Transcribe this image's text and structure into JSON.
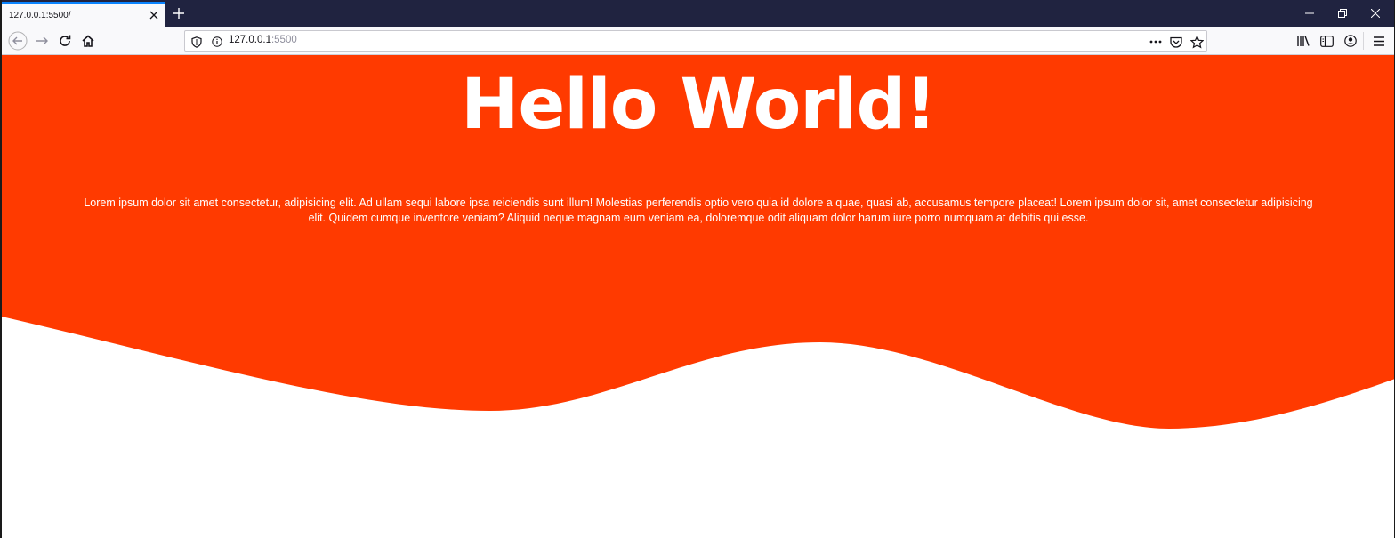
{
  "browser": {
    "tab": {
      "title": "127.0.0.1:5500/"
    },
    "url": {
      "host": "127.0.0.1",
      "port": ":5500"
    },
    "icons": [
      "close-icon",
      "plus-icon",
      "minimize-icon",
      "restore-icon",
      "back-icon",
      "forward-icon",
      "reload-icon",
      "home-icon",
      "shield-icon",
      "info-icon",
      "more-icon",
      "pocket-icon",
      "star-icon",
      "library-icon",
      "sidebar-icon",
      "account-icon",
      "menu-icon"
    ]
  },
  "page": {
    "title": "Hello World!",
    "body": "Lorem ipsum dolor sit amet consectetur, adipisicing elit. Ad ullam sequi labore ipsa reiciendis sunt illum! Molestias perferendis optio vero quia id dolore a quae, quasi ab, accusamus tempore placeat! Lorem ipsum dolor sit, amet consectetur adipisicing elit. Quidem cumque inventore veniam? Aliquid neque magnam eum veniam ea, doloremque odit aliquam dolor harum iure porro numquam at debitis qui esse."
  },
  "colors": {
    "accent": "#ff3a00",
    "tabstrip": "#202340",
    "white": "#ffffff"
  }
}
